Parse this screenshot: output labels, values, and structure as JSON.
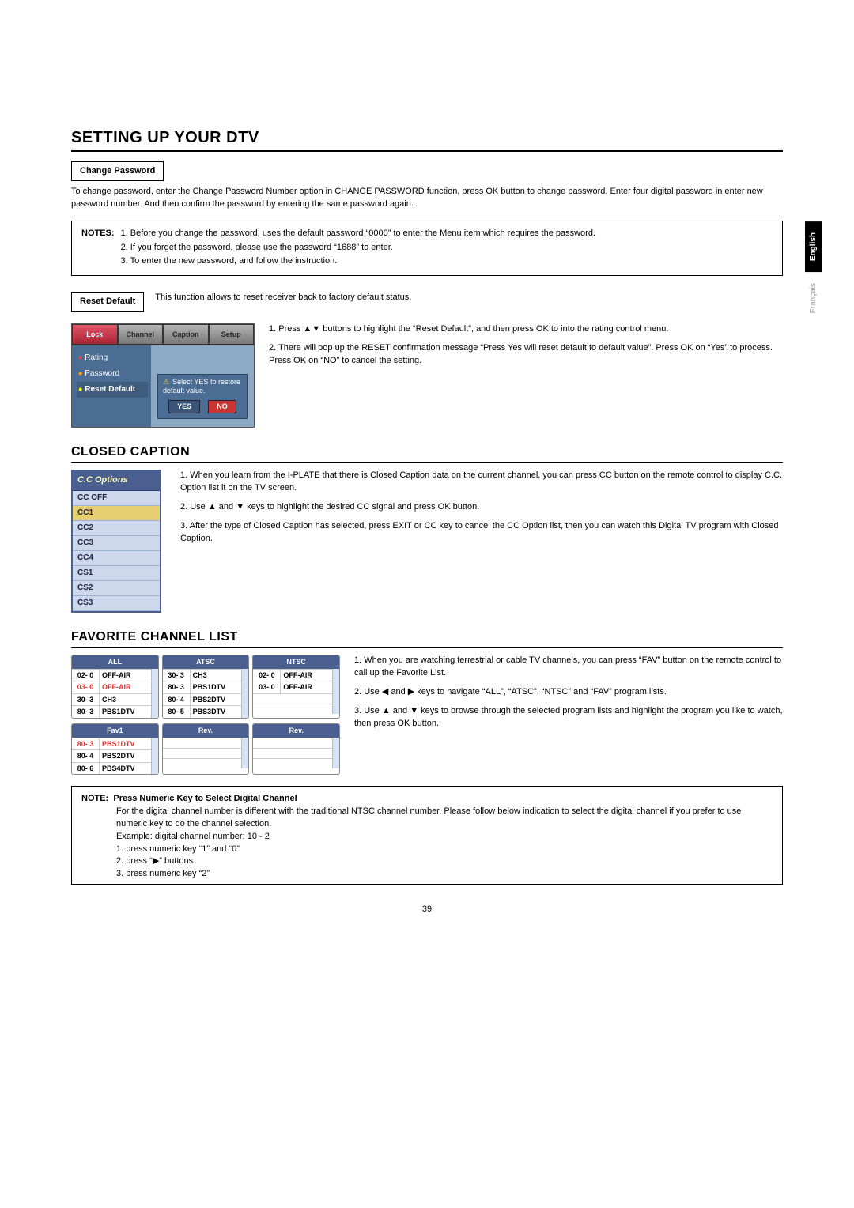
{
  "lang": {
    "english": "English",
    "french": "Français"
  },
  "h1": "SETTING UP YOUR DTV",
  "changePassword": {
    "label": "Change Password",
    "para": "To change password, enter the Change Password Number option in CHANGE PASSWORD function, press OK button to change password. Enter four digital password in enter new password number. And then confirm the password by entering the same password again."
  },
  "notes": {
    "label": "NOTES:",
    "items": [
      "1. Before you change the password, uses the default password “0000” to enter the Menu item which requires the password.",
      "2. If you forget the password, please use the password “1688” to enter.",
      "3. To enter the new password, and follow the instruction."
    ]
  },
  "resetDefault": {
    "label": "Reset Default",
    "inline": "This function allows to reset receiver back to factory default status.",
    "steps": [
      "1. Press ▲▼ buttons to highlight the “Reset Default”, and then press OK to into the rating control menu.",
      "2. There will pop up the RESET confirmation message “Press Yes will reset default to default value”. Press OK on “Yes” to process. Press OK on “NO” to cancel the setting."
    ],
    "menu": {
      "tabs": [
        "Lock",
        "Channel",
        "Caption",
        "Setup"
      ],
      "side": [
        "Rating",
        "Password",
        "Reset Default"
      ],
      "popup": "Select YES to restore default value.",
      "yes": "YES",
      "no": "NO"
    }
  },
  "closedCaption": {
    "title": "CLOSED CAPTION",
    "ill": {
      "head": "C.C Options",
      "rows": [
        "CC OFF",
        "CC1",
        "CC2",
        "CC3",
        "CC4",
        "CS1",
        "CS2",
        "CS3"
      ]
    },
    "steps": [
      "1. When you learn from the I-PLATE that there is Closed Caption data on the current channel, you can press CC button on the remote control to display C.C. Option list it on the TV screen.",
      "2. Use ▲ and ▼ keys to highlight the desired CC signal and press OK button.",
      "3. After the type of Closed Caption has selected, press EXIT or CC key to cancel the CC Option list, then you can watch this Digital TV program with Closed Caption."
    ]
  },
  "favorite": {
    "title": "FAVORITE CHANNEL LIST",
    "panes": {
      "all": {
        "head": "ALL",
        "rows": [
          [
            "02- 0",
            "OFF-AIR"
          ],
          [
            "03- 0",
            "OFF-AIR"
          ],
          [
            "30- 3",
            "CH3"
          ],
          [
            "80- 3",
            "PBS1DTV"
          ]
        ]
      },
      "atsc": {
        "head": "ATSC",
        "rows": [
          [
            "30- 3",
            "CH3"
          ],
          [
            "80- 3",
            "PBS1DTV"
          ],
          [
            "80- 4",
            "PBS2DTV"
          ],
          [
            "80- 5",
            "PBS3DTV"
          ]
        ]
      },
      "ntsc": {
        "head": "NTSC",
        "rows": [
          [
            "02- 0",
            "OFF-AIR"
          ],
          [
            "03- 0",
            "OFF-AIR"
          ]
        ]
      },
      "fav1": {
        "head": "Fav1",
        "rows": [
          [
            "80- 3",
            "PBS1DTV"
          ],
          [
            "80- 4",
            "PBS2DTV"
          ],
          [
            "80- 6",
            "PBS4DTV"
          ]
        ]
      },
      "rev1": {
        "head": "Rev."
      },
      "rev2": {
        "head": "Rev."
      }
    },
    "steps": [
      "1. When you are watching terrestrial or cable TV channels, you can press “FAV” button on the remote control to call up the Favorite List.",
      "2. Use ◀ and ▶ keys to navigate “ALL”, “ATSC”, “NTSC” and “FAV” program lists.",
      "3. Use ▲ and ▼ keys to browse through the selected program lists and highlight the program you like to watch, then press OK button."
    ]
  },
  "note2": {
    "label": "NOTE:",
    "sub": "Press Numeric Key to Select Digital Channel",
    "body": [
      "For the digital channel number is different with the traditional NTSC channel number. Please follow below indication to select the digital channel if you prefer to use numeric key to do the channel selection.",
      "Example: digital channel number: 10 - 2",
      "1. press numeric key “1” and “0”",
      "2. press “▶” buttons",
      "3. press numeric key “2”"
    ]
  },
  "pageNum": "39"
}
